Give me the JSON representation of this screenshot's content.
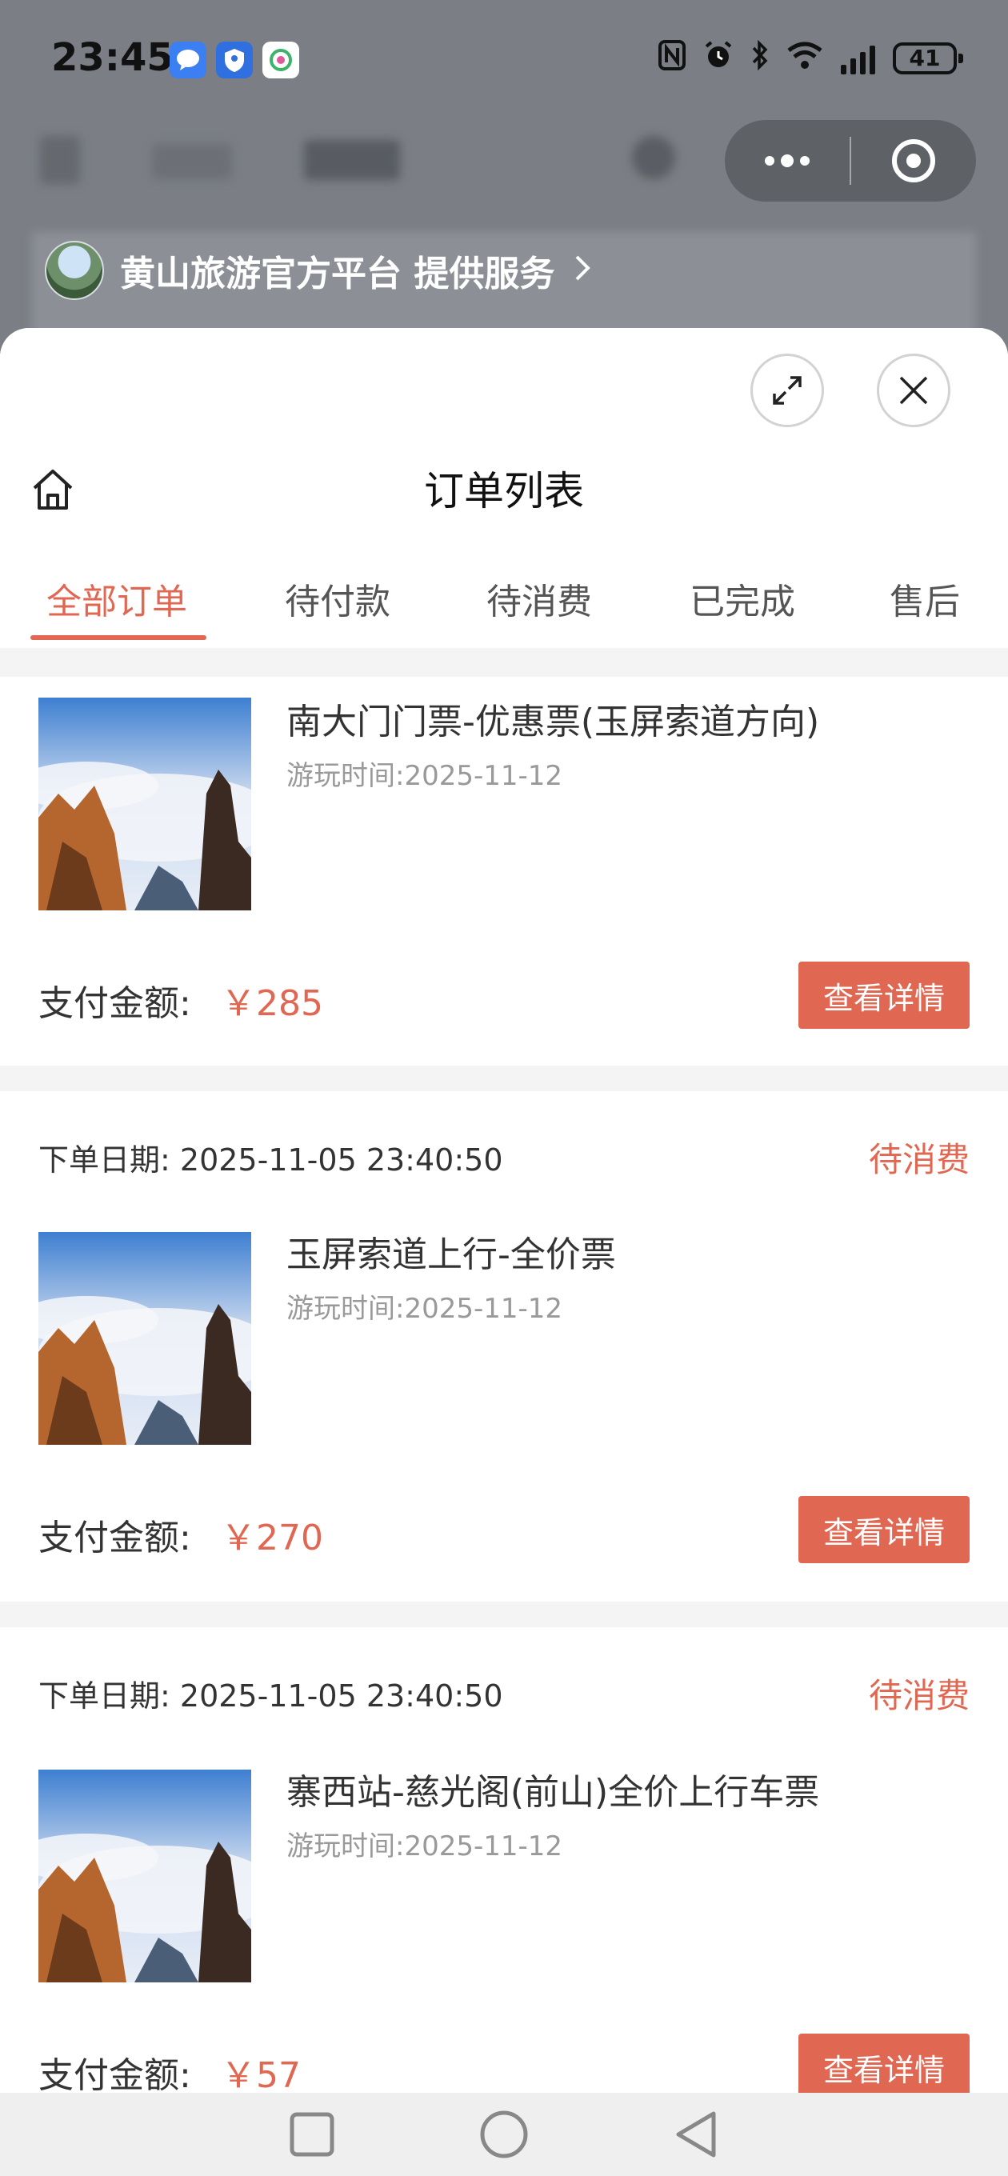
{
  "status_bar": {
    "time": "23:45",
    "battery": "41",
    "app_icons": [
      "message-app-icon",
      "security-app-icon",
      "mobile-app-icon"
    ],
    "indicator_icons": [
      "nfc-icon",
      "alarm-icon",
      "bluetooth-icon",
      "wifi-icon",
      "signal-icon"
    ]
  },
  "provider": {
    "text": "黄山旅游官方平台 提供服务"
  },
  "page": {
    "title": "订单列表"
  },
  "tabs": [
    {
      "label": "全部订单",
      "active": true
    },
    {
      "label": "待付款",
      "active": false
    },
    {
      "label": "待消费",
      "active": false
    },
    {
      "label": "已完成",
      "active": false
    },
    {
      "label": "售后",
      "active": false
    }
  ],
  "orders": [
    {
      "date_label": "",
      "date": "",
      "status": "",
      "name": "南大门门票-优惠票(玉屏索道方向)",
      "visit": "游玩时间:2025-11-12",
      "amount_label": "支付金额:",
      "amount": "￥285",
      "button": "查看详情"
    },
    {
      "date_label": "下单日期:",
      "date": "2025-11-05 23:40:50",
      "status": "待消费",
      "name": "玉屏索道上行-全价票",
      "visit": "游玩时间:2025-11-12",
      "amount_label": "支付金额:",
      "amount": "￥270",
      "button": "查看详情"
    },
    {
      "date_label": "下单日期:",
      "date": "2025-11-05 23:40:50",
      "status": "待消费",
      "name": "寨西站-慈光阁(前山)全价上行车票",
      "visit": "游玩时间:2025-11-12",
      "amount_label": "支付金额:",
      "amount": "￥57",
      "button": "查看详情"
    }
  ],
  "colors": {
    "accent": "#e06752",
    "muted_text": "#999999",
    "body_text": "#333333"
  }
}
